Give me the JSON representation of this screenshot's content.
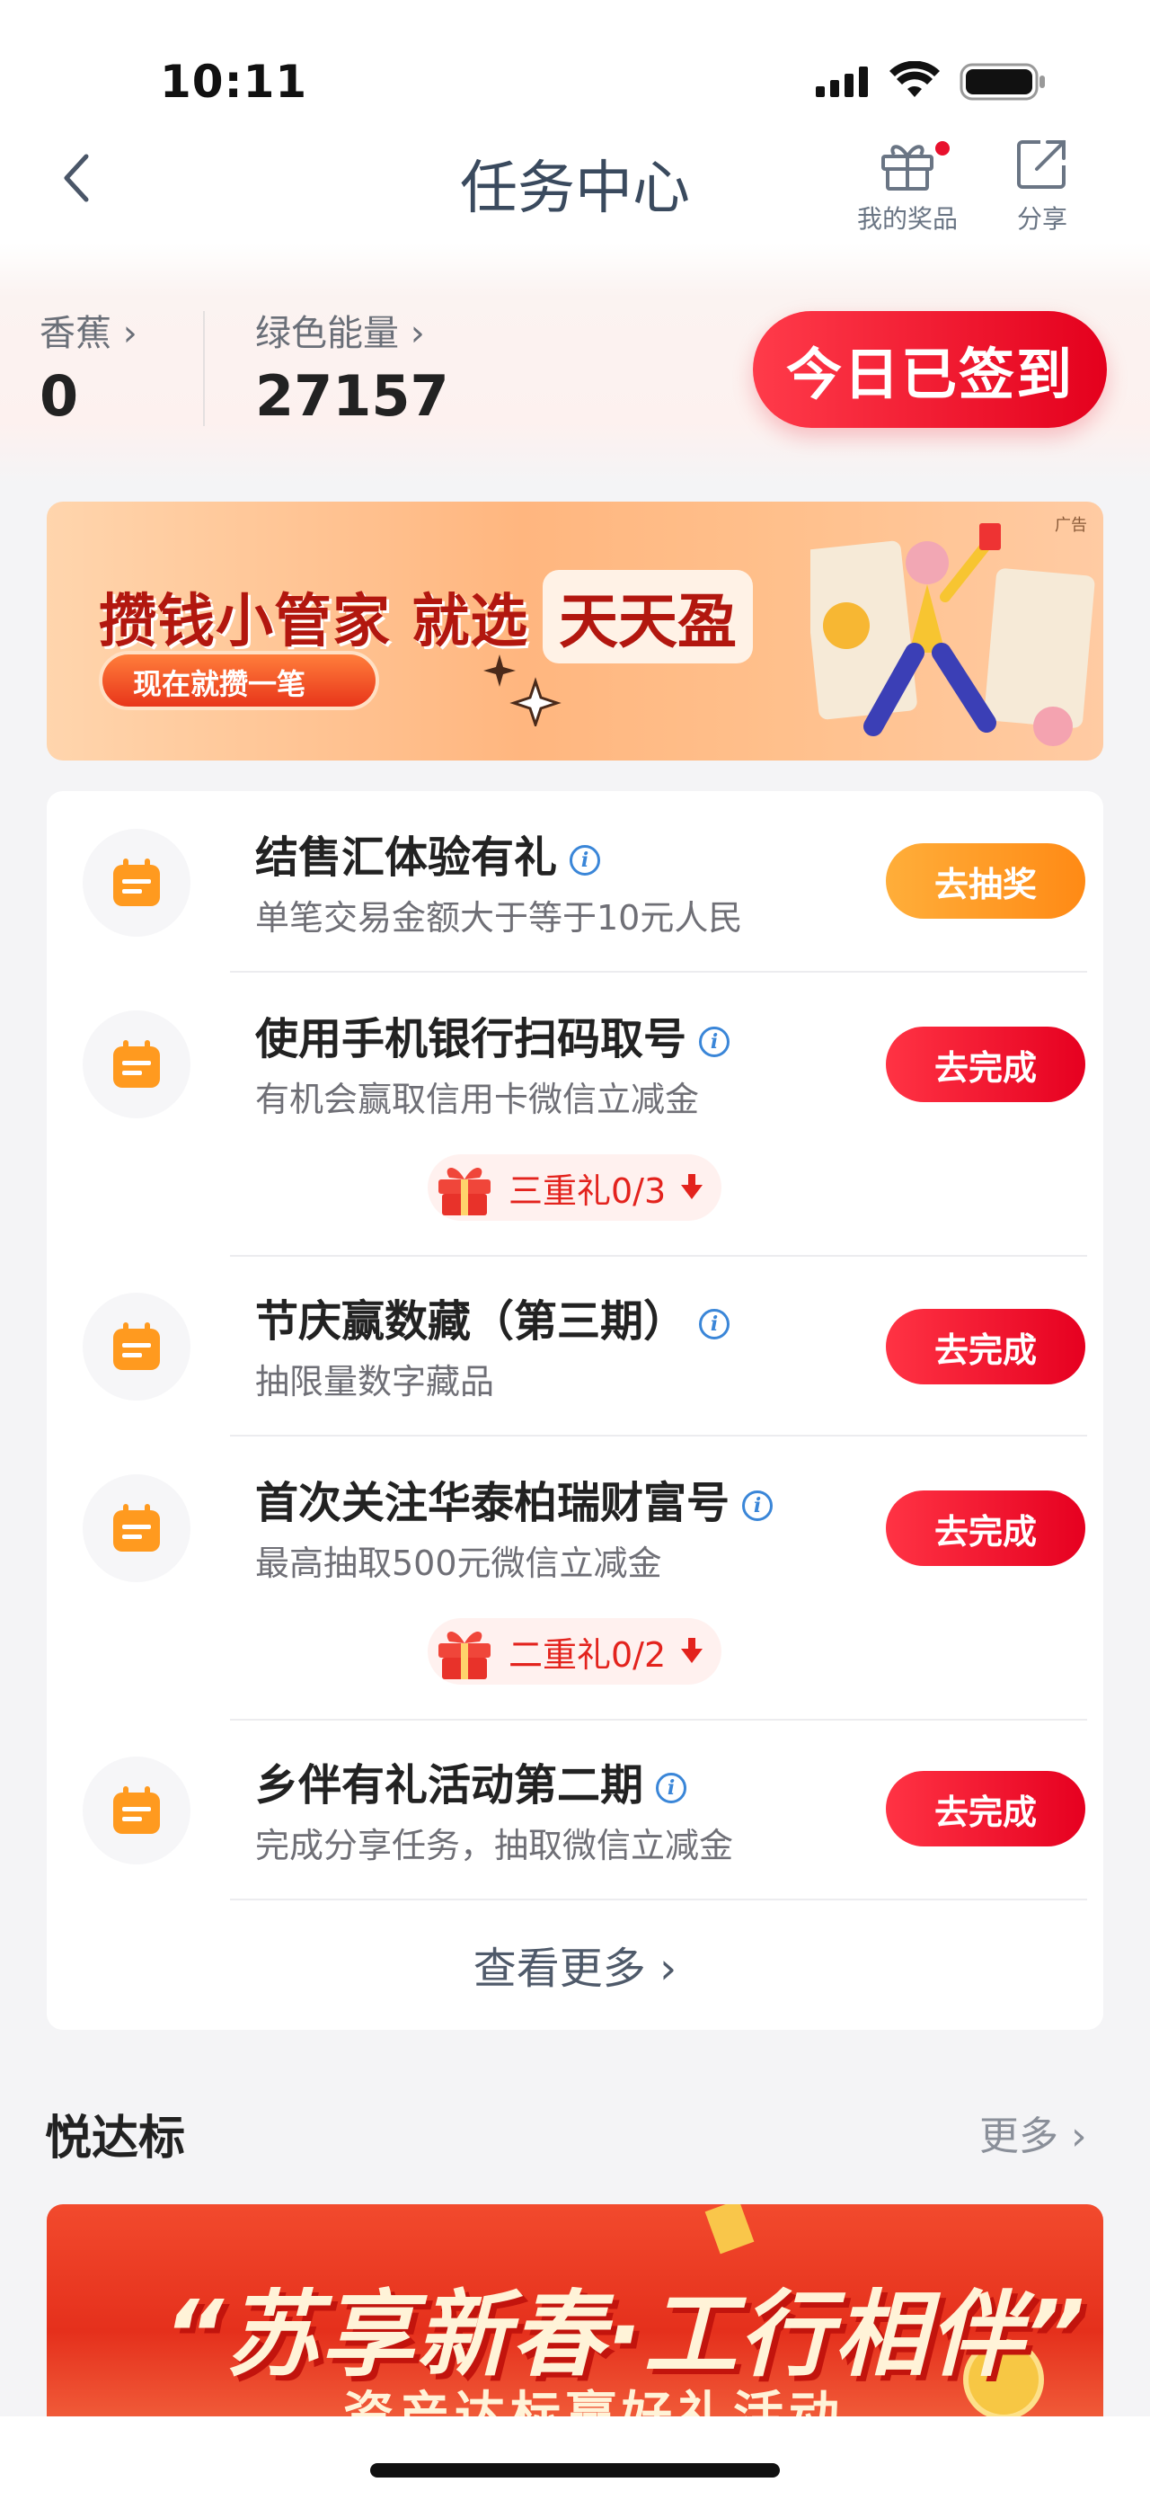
{
  "status_bar": {
    "time": "10:11"
  },
  "nav": {
    "title": "任务中心",
    "my_prizes_label": "我的奖品",
    "share_label": "分享"
  },
  "stats": {
    "banana_label": "香蕉",
    "banana_value": "0",
    "energy_label": "绿色能量",
    "energy_value": "27157",
    "signin_label": "今日已签到"
  },
  "ad_banner": {
    "ad_tag": "广告",
    "headline": "攒钱小管家 就选",
    "headline_brand": "天天盈",
    "cta": "现在就攒一笔"
  },
  "tasks": [
    {
      "title": "结售汇体验有礼",
      "desc": "单笔交易金额大于等于10元人民",
      "button": "去抽奖"
    },
    {
      "title": "使用手机银行扫码取号",
      "desc": "有机会赢取信用卡微信立减金",
      "button": "去完成",
      "gift": "三重礼0/3"
    },
    {
      "title": "节庆赢数藏（第三期）",
      "desc": "抽限量数字藏品",
      "button": "去完成"
    },
    {
      "title": "首次关注华泰柏瑞财富号",
      "desc": "最高抽取500元微信立减金",
      "button": "去完成",
      "gift": "二重礼0/2"
    },
    {
      "title": "乡伴有礼活动第二期",
      "desc": "完成分享任务，抽取微信立减金",
      "button": "去完成"
    }
  ],
  "see_more": "查看更多",
  "section": {
    "title": "悦达标",
    "more": "更多"
  },
  "promo_banner": {
    "title": "“苏享新春·工行相伴”",
    "subtitle": "资产达标赢好礼活动"
  },
  "colors": {
    "primary_red": "#e60020",
    "orange": "#ff8a15",
    "icon_orange": "#ff9a1f",
    "info_blue": "#3a86d8"
  }
}
